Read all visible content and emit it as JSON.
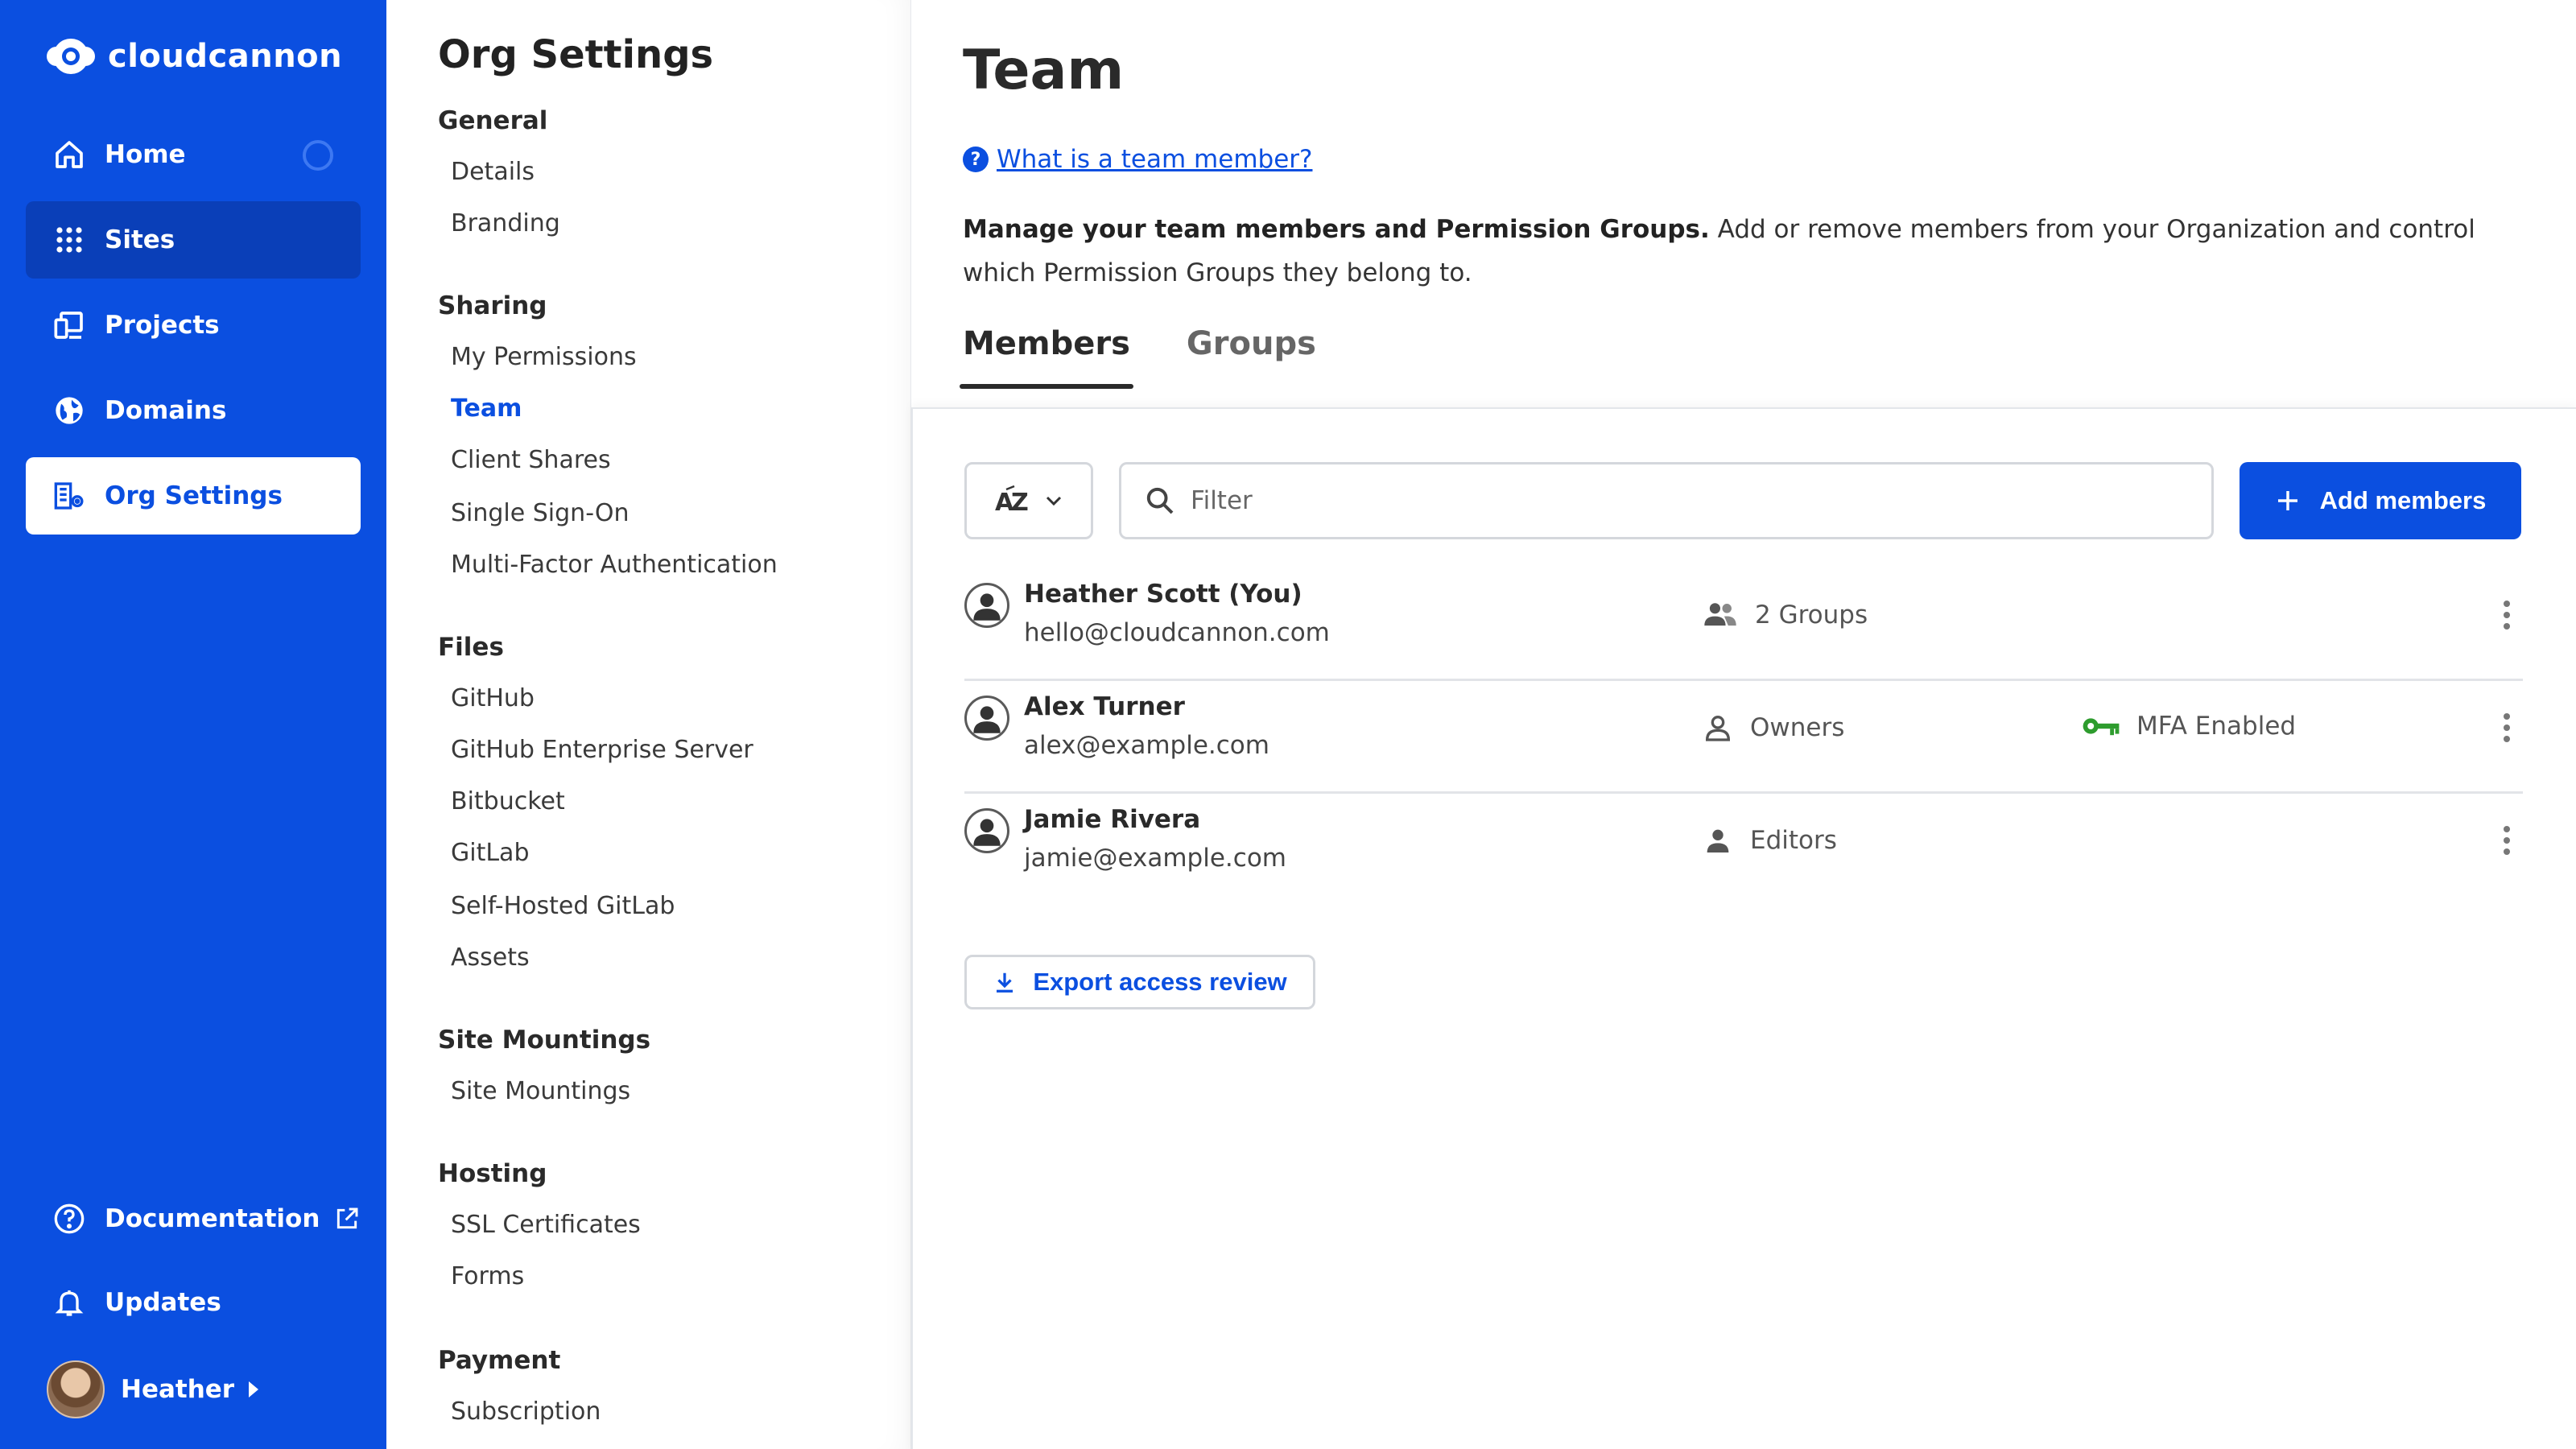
{
  "app": {
    "logo_text": "cloudcannon",
    "nav": [
      {
        "label": "Home",
        "icon": "home-icon"
      },
      {
        "label": "Sites",
        "icon": "grid-icon"
      },
      {
        "label": "Projects",
        "icon": "projects-icon"
      },
      {
        "label": "Domains",
        "icon": "globe-icon"
      },
      {
        "label": "Org Settings",
        "icon": "org-settings-icon"
      }
    ],
    "bottom": {
      "documentation": "Documentation",
      "updates": "Updates",
      "user": "Heather"
    }
  },
  "settings": {
    "title": "Org Settings",
    "sections": [
      {
        "heading": "General",
        "items": [
          "Details",
          "Branding"
        ]
      },
      {
        "heading": "Sharing",
        "items": [
          "My Permissions",
          "Team",
          "Client Shares",
          "Single Sign-On",
          "Multi-Factor Authentication"
        ]
      },
      {
        "heading": "Files",
        "items": [
          "GitHub",
          "GitHub Enterprise Server",
          "Bitbucket",
          "GitLab",
          "Self-Hosted GitLab",
          "Assets"
        ]
      },
      {
        "heading": "Site Mountings",
        "items": [
          "Site Mountings"
        ]
      },
      {
        "heading": "Hosting",
        "items": [
          "SSL Certificates",
          "Forms"
        ]
      },
      {
        "heading": "Payment",
        "items": [
          "Subscription"
        ]
      }
    ],
    "active_item": "Team"
  },
  "main": {
    "title": "Team",
    "help_link": "What is a team member?",
    "description_bold": "Manage your team members and Permission Groups.",
    "description_rest": " Add or remove members from your Organization and control which Permission Groups they belong to.",
    "tabs": [
      "Members",
      "Groups"
    ],
    "active_tab": "Members",
    "sort_label": "AZ",
    "filter_placeholder": "Filter",
    "add_members": "Add members",
    "members": [
      {
        "name": "Heather Scott (You)",
        "email": "hello@cloudcannon.com",
        "group": "2 Groups",
        "group_icon": "groups-icon",
        "mfa": ""
      },
      {
        "name": "Alex Turner",
        "email": "alex@example.com",
        "group": "Owners",
        "group_icon": "person-outline-icon",
        "mfa": "MFA Enabled"
      },
      {
        "name": "Jamie Rivera",
        "email": "jamie@example.com",
        "group": "Editors",
        "group_icon": "person-filled-icon",
        "mfa": ""
      }
    ],
    "export": "Export access review"
  },
  "colors": {
    "brand_blue": "#0b4fe0",
    "sidebar_active_dark": "#0a3fb8",
    "mfa_green": "#2e9c2e"
  }
}
